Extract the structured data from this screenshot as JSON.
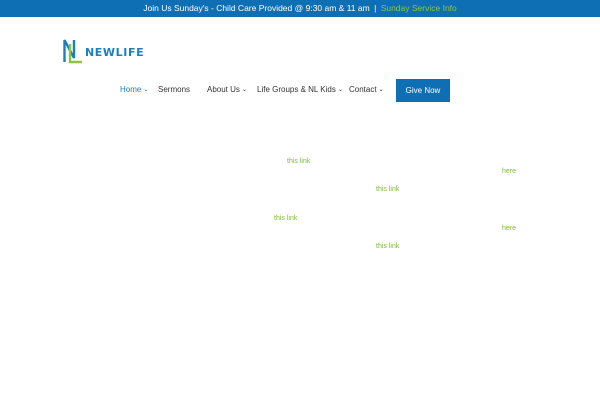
{
  "announcement": {
    "text": "Join Us Sunday's - Child Care Provided @ 9:30 am & 11 am",
    "separator": "|",
    "link_label": "Sunday Service Info"
  },
  "logo": {
    "wordmark": "NEWLIFE",
    "monogram": "NL",
    "colors": {
      "blue": "#1b7fc4",
      "green": "#8cc63f"
    }
  },
  "nav": {
    "items": [
      {
        "label": "Home",
        "has_dropdown": true,
        "active": true
      },
      {
        "label": "Sermons",
        "has_dropdown": false,
        "active": false
      },
      {
        "label": "About Us",
        "has_dropdown": true,
        "active": false
      },
      {
        "label": "Life Groups & NL Kids",
        "has_dropdown": true,
        "active": false
      },
      {
        "label": "Contact",
        "has_dropdown": true,
        "active": false
      }
    ],
    "cta_label": "Give Now"
  },
  "content": {
    "links": [
      {
        "label": "this link"
      },
      {
        "label": "here"
      },
      {
        "label": "this link"
      },
      {
        "label": "this link"
      },
      {
        "label": "here"
      },
      {
        "label": "this link"
      }
    ]
  },
  "theme": {
    "primary_blue": "#0f6fb5",
    "link_green": "#7cb83a",
    "active_blue": "#1b7fc4",
    "chevron_icon": "chevron-down-icon"
  }
}
